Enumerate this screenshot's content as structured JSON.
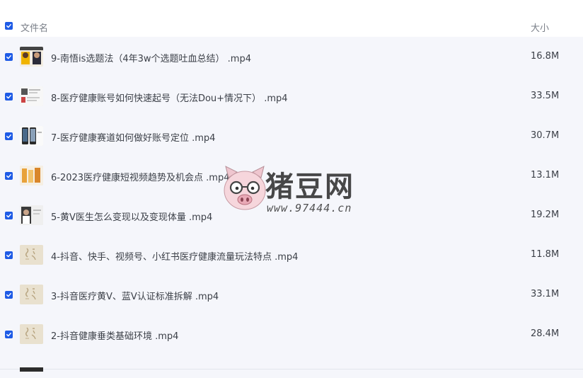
{
  "header": {
    "select_all_checked": true,
    "name_column": "文件名",
    "size_column": "大小"
  },
  "files": [
    {
      "name": "9-南悟is选题法（4年3w个选题吐血总结） .mp4",
      "size": "16.8M",
      "checked": true,
      "thumb": "people"
    },
    {
      "name": "8-医疗健康账号如何快速起号（无法Dou+情况下） .mp4",
      "size": "33.5M",
      "checked": true,
      "thumb": "doc"
    },
    {
      "name": "7-医疗健康赛道如何做好账号定位 .mp4",
      "size": "30.7M",
      "checked": true,
      "thumb": "phones"
    },
    {
      "name": "6-2023医疗健康短视频趋势及机会点 .mp4",
      "size": "13.1M",
      "checked": true,
      "thumb": "orange"
    },
    {
      "name": "5-黄V医生怎么变现以及变现体量 .mp4",
      "size": "19.2M",
      "checked": true,
      "thumb": "portrait"
    },
    {
      "name": "4-抖音、快手、视频号、小红书医疗健康流量玩法特点 .mp4",
      "size": "11.8M",
      "checked": true,
      "thumb": "calligraphy"
    },
    {
      "name": "3-抖音医疗黄V、蓝V认证标准拆解 .mp4",
      "size": "33.1M",
      "checked": true,
      "thumb": "calligraphy"
    },
    {
      "name": "2-抖音健康垂类基础环境 .mp4",
      "size": "28.4M",
      "checked": true,
      "thumb": "calligraphy"
    }
  ],
  "watermark": {
    "title": "猪豆网",
    "url": "www.97444.cn"
  },
  "colors": {
    "accent": "#1e5be6",
    "list_bg": "#f5f6fb"
  }
}
